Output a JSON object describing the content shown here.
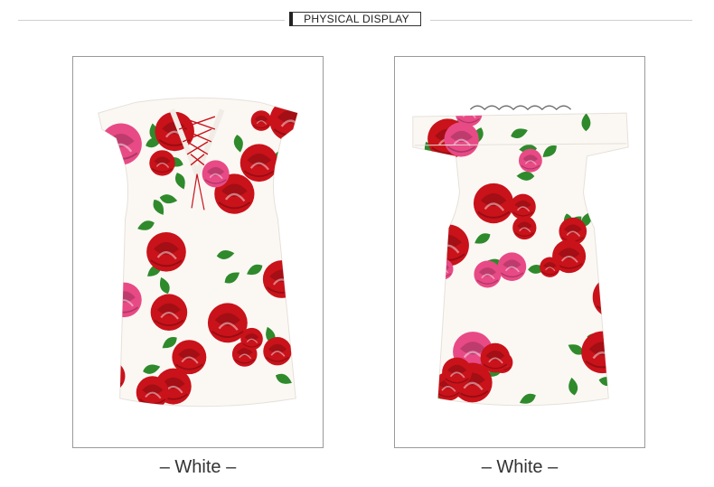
{
  "header": {
    "title": "PHYSICAL DISPLAY"
  },
  "panels": [
    {
      "caption": "– White –",
      "variant": "front-lace-up",
      "color": "White"
    },
    {
      "caption": "– White –",
      "variant": "off-shoulder-ruffle",
      "color": "White"
    }
  ],
  "colors": {
    "rose_red": "#c9121a",
    "rose_pink": "#e84a86",
    "leaf_green": "#2f8a2c",
    "fabric": "#fbf8f4"
  }
}
